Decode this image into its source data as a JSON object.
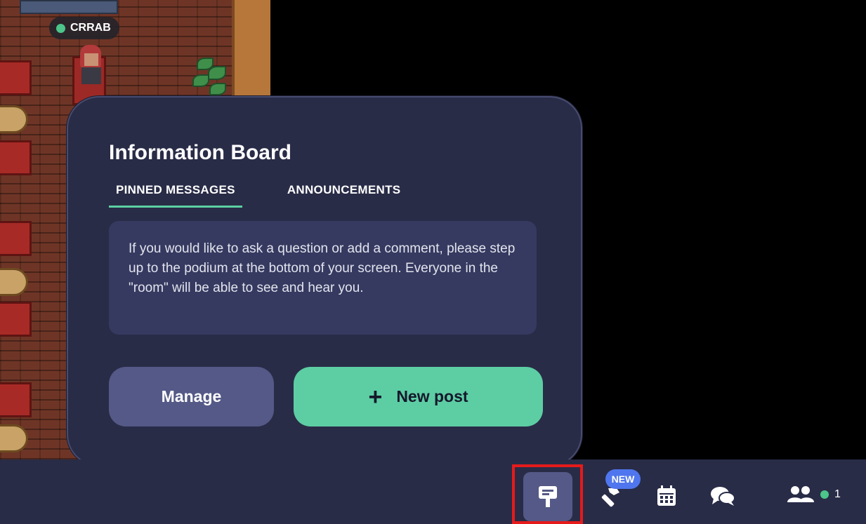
{
  "player": {
    "name": "CRRAB",
    "status_color": "#4cc48a"
  },
  "board": {
    "title": "Information Board",
    "tabs": [
      {
        "label": "PINNED MESSAGES",
        "active": true
      },
      {
        "label": "ANNOUNCEMENTS",
        "active": false
      }
    ],
    "pinned_message": "If you would like to ask a question or add a comment, please step up to the podium at the bottom of your screen. Everyone in the \"room\" will be able to see and hear you.",
    "manage_label": "Manage",
    "new_post_icon": "+",
    "new_post_label": "New post"
  },
  "toolbar": {
    "items": [
      {
        "icon": "signpost-icon",
        "selected": true
      },
      {
        "icon": "hammer-icon",
        "badge": "NEW"
      },
      {
        "icon": "calendar-icon"
      },
      {
        "icon": "chat-icon"
      },
      {
        "icon": "participants-icon"
      }
    ],
    "online_count": "1"
  },
  "colors": {
    "panel_bg": "#292c47",
    "accent_green": "#5dcea4",
    "manage_bg": "#545987",
    "badge_blue": "#4f76ee",
    "highlight_red": "#e51b1b"
  }
}
